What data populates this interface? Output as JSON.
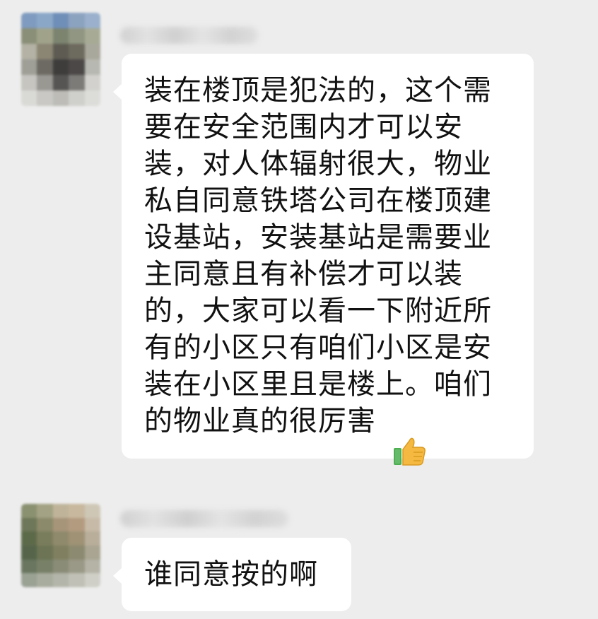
{
  "messages": [
    {
      "sender": "contact-1",
      "text": "装在楼顶是犯法的，这个需要在安全范围内才可以安装，对人体辐射很大，物业私自同意铁塔公司在楼顶建设基站，安装基站是需要业主同意且有补偿才可以装的，大家可以看一下附近所有的小区只有咱们小区是安装在小区里且是楼上。咱们的物业真的很厉害",
      "emoji": "thumbs-up-icon"
    },
    {
      "sender": "contact-2",
      "text": "谁同意按的啊"
    }
  ],
  "colors": {
    "background": "#ededed",
    "bubble": "#ffffff",
    "text": "#111111"
  }
}
